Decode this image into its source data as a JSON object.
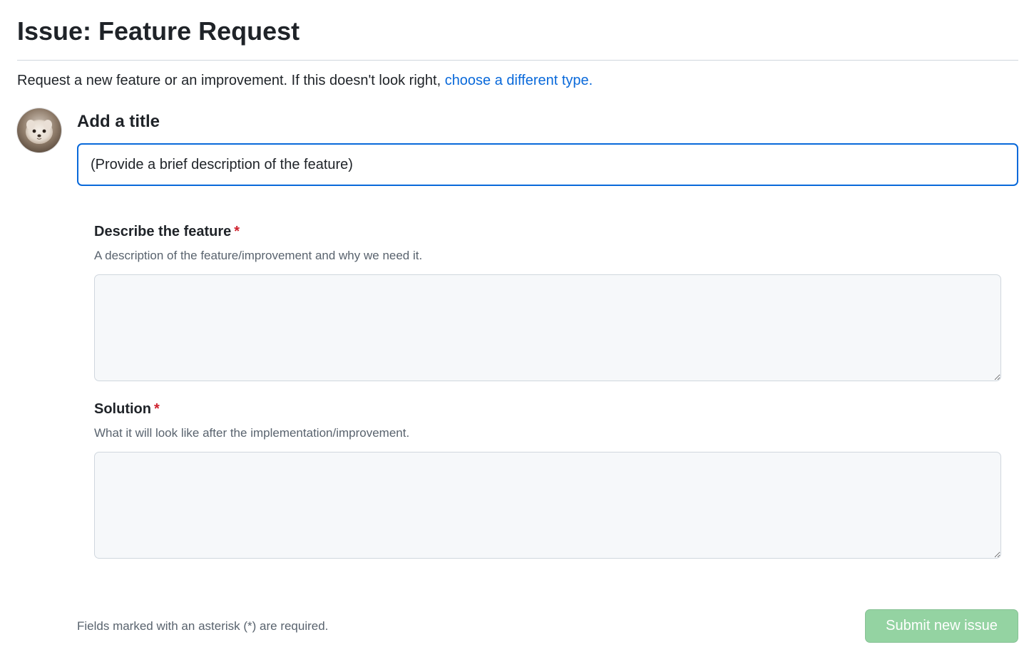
{
  "page": {
    "title": "Issue: Feature Request"
  },
  "intro": {
    "text": "Request a new feature or an improvement. If this doesn't look right, ",
    "link_label": "choose a different type."
  },
  "title_section": {
    "label": "Add a title",
    "input_value": "(Provide a brief description of the feature)"
  },
  "fields": [
    {
      "label": "Describe the feature",
      "required_marker": "*",
      "description": "A description of the feature/improvement and why we need it.",
      "value": ""
    },
    {
      "label": "Solution",
      "required_marker": "*",
      "description": "What it will look like after the implementation/improvement.",
      "value": ""
    }
  ],
  "footer": {
    "note": "Fields marked with an asterisk (*) are required.",
    "submit_label": "Submit new issue"
  },
  "colors": {
    "link": "#0969da",
    "required": "#cf222e",
    "input_focus_border": "#0969da",
    "submit_disabled_bg": "#94d3a2"
  },
  "icons": {
    "avatar": "user-avatar"
  }
}
